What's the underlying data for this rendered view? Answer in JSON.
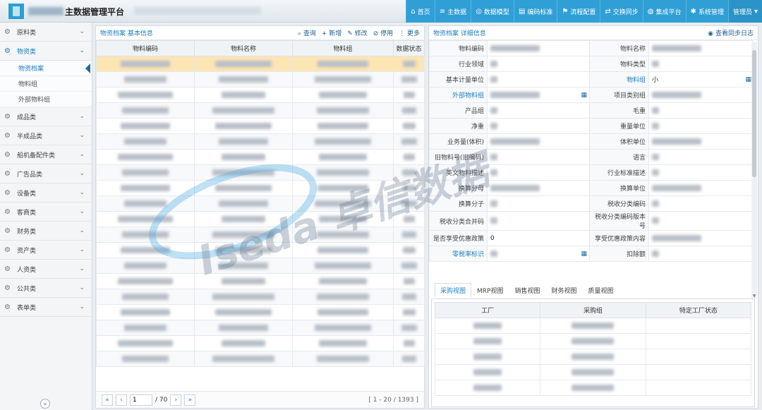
{
  "app": {
    "title": "主数据管理平台"
  },
  "topnav": [
    {
      "label": "首页",
      "icon": "home-icon",
      "glyph": "⌂"
    },
    {
      "label": "主数据",
      "icon": "database-icon",
      "glyph": "≡"
    },
    {
      "label": "数据模型",
      "icon": "model-icon",
      "glyph": "◎"
    },
    {
      "label": "编码标准",
      "icon": "table-icon",
      "glyph": "▤"
    },
    {
      "label": "流程配置",
      "icon": "flow-icon",
      "glyph": "⚑"
    },
    {
      "label": "交换同步",
      "icon": "sync-icon",
      "glyph": "⇄"
    },
    {
      "label": "集成平台",
      "icon": "globe-icon",
      "glyph": "◍"
    },
    {
      "label": "系统管理",
      "icon": "gear-icon",
      "glyph": "✱"
    },
    {
      "label": "管理员",
      "icon": "chevron-down-icon",
      "glyph": "▾"
    }
  ],
  "sidebar": {
    "items": [
      {
        "label": "原料类",
        "open": false
      },
      {
        "label": "物资类",
        "open": true,
        "children": [
          {
            "label": "物资档案",
            "active": true
          },
          {
            "label": "物料组",
            "active": false
          },
          {
            "label": "外部物料组",
            "active": false
          }
        ]
      },
      {
        "label": "成品类",
        "open": false
      },
      {
        "label": "半成品类",
        "open": false
      },
      {
        "label": "船机备配件类",
        "open": false
      },
      {
        "label": "广告品类",
        "open": false
      },
      {
        "label": "设备类",
        "open": false
      },
      {
        "label": "客商类",
        "open": false
      },
      {
        "label": "财务类",
        "open": false
      },
      {
        "label": "资产类",
        "open": false
      },
      {
        "label": "人资类",
        "open": false
      },
      {
        "label": "公共类",
        "open": false
      },
      {
        "label": "表单类",
        "open": false
      }
    ]
  },
  "left_panel": {
    "title": "物资档案 基本信息",
    "tools": [
      {
        "label": "查询",
        "icon": "search-icon",
        "glyph": "⌕"
      },
      {
        "label": "新增",
        "icon": "plus-icon",
        "glyph": "+"
      },
      {
        "label": "修改",
        "icon": "edit-icon",
        "glyph": "✎"
      },
      {
        "label": "停用",
        "icon": "lock-icon",
        "glyph": "⊘"
      },
      {
        "label": "更多",
        "icon": "more-icon",
        "glyph": "⋮"
      }
    ],
    "columns": [
      "物料编码",
      "物料名称",
      "物料组",
      "数据状态"
    ],
    "row_count": 20,
    "selected_row": 0,
    "pager": {
      "page": "1",
      "total_pages": "/ 70",
      "info": "[ 1 - 20 / 1393 ]"
    }
  },
  "right_panel": {
    "title": "物资档案 详细信息",
    "tools": [
      {
        "label": "查看同步日志",
        "icon": "eye-icon",
        "glyph": "◉"
      }
    ],
    "fields": [
      [
        "物料编码",
        "",
        "物料名称",
        ""
      ],
      [
        "行业领域",
        "",
        "物料类型",
        ""
      ],
      [
        "基本计量单位",
        "",
        "物料组",
        "小"
      ],
      [
        "外部物料组",
        "",
        "项目类别组",
        ""
      ],
      [
        "产品组",
        "",
        "毛重",
        ""
      ],
      [
        "净重",
        "",
        "重量单位",
        ""
      ],
      [
        "业务量(体积)",
        "",
        "体积单位",
        ""
      ],
      [
        "旧物料号(旧编码)",
        "",
        "语言",
        ""
      ],
      [
        "英文物料描述",
        "",
        "行业标准描述",
        ""
      ],
      [
        "换算分母",
        "",
        "换算单位",
        ""
      ],
      [
        "换算分子",
        "",
        "税收分类编码",
        ""
      ],
      [
        "税收分类合并码",
        "",
        "税收分类编码版本号",
        ""
      ],
      [
        "是否享受优惠政策",
        "0",
        "享受优惠政策内容",
        ""
      ],
      [
        "零税率标识",
        "",
        "扣除额",
        ""
      ]
    ],
    "link_labels": [
      "物料组",
      "外部物料组",
      "零税率标识"
    ],
    "tabs": [
      "采购视图",
      "MRP视图",
      "销售视图",
      "财务视图",
      "质量视图"
    ],
    "active_tab": 0,
    "sub_columns": [
      "工厂",
      "采购组",
      "特定工厂状态"
    ],
    "sub_row_count": 5
  },
  "watermark": {
    "text": "Iseda 卓信数据"
  }
}
